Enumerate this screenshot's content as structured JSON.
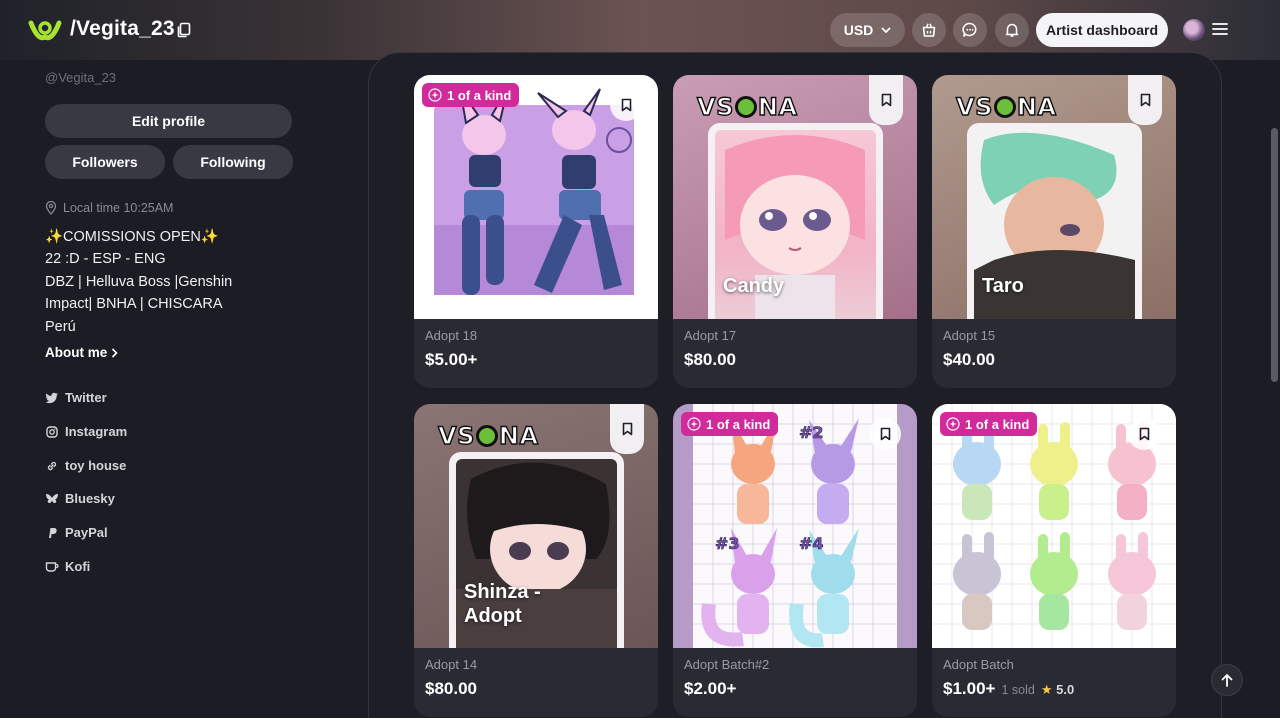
{
  "header": {
    "shop_handle": "/Vegita_23",
    "currency": "USD",
    "artist_dashboard_label": "Artist dashboard"
  },
  "sidebar": {
    "handle": "@Vegita_23",
    "edit_profile_label": "Edit profile",
    "followers_label": "Followers",
    "following_label": "Following",
    "local_time": "Local time 10:25AM",
    "bio": [
      "✨COMISSIONS OPEN✨",
      "22 :D - ESP - ENG",
      "DBZ | Helluva Boss |Genshin",
      "Impact| BNHA | CHISCARA",
      "Perú"
    ],
    "about_label": "About me",
    "links": [
      {
        "label": "Twitter",
        "icon": "twitter-icon"
      },
      {
        "label": "Instagram",
        "icon": "instagram-icon"
      },
      {
        "label": "toy house",
        "icon": "link-icon"
      },
      {
        "label": "Bluesky",
        "icon": "bluesky-icon"
      },
      {
        "label": "PayPal",
        "icon": "paypal-icon"
      },
      {
        "label": "Kofi",
        "icon": "kofi-icon"
      }
    ]
  },
  "listings": [
    {
      "title": "Adopt 18",
      "price": "$5.00+",
      "badge": "1 of a kind"
    },
    {
      "title": "Adopt 17",
      "price": "$80.00",
      "brand": "VSONA",
      "character": "Candy"
    },
    {
      "title": "Adopt 15",
      "price": "$40.00",
      "brand": "VSONA",
      "character": "Taro"
    },
    {
      "title": "Adopt 14",
      "price": "$80.00",
      "brand": "VSONA",
      "character": "Shinza -\nAdopt"
    },
    {
      "title": "Adopt Batch#2",
      "price": "$2.00+",
      "badge": "1 of a kind"
    },
    {
      "title": "Adopt Batch",
      "price": "$1.00+",
      "badge": "1 of a kind",
      "sold": "1 sold",
      "rating": "5.0"
    }
  ],
  "colors": {
    "badge": "#d12a9b",
    "logo_green": "#a6e22e",
    "star": "#f2c94c"
  }
}
